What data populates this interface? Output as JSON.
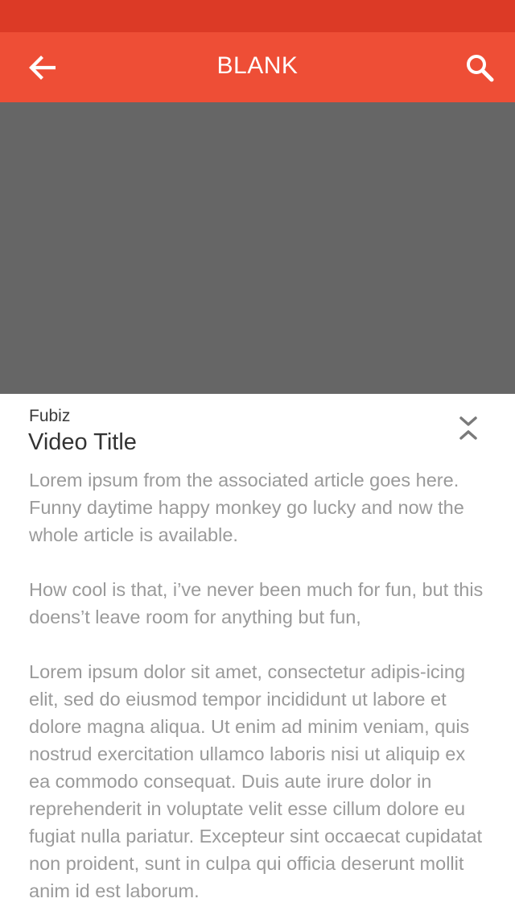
{
  "app_bar": {
    "title": "BLANK",
    "back_icon": "arrow-back-icon",
    "search_icon": "search-icon"
  },
  "colors": {
    "status_bar": "#dc3a26",
    "app_bar": "#ee4e36",
    "video_placeholder": "#666666",
    "body_text": "#9a9a9a"
  },
  "video": {
    "source": "Fubiz",
    "title": "Video Title",
    "toggle_icon": "collapse-expand-chevrons-icon"
  },
  "article": {
    "paragraphs": [
      "Lorem ipsum from the associated article goes here. Funny daytime happy monkey go lucky and now the whole article is available.",
      "How cool is that, i’ve never been much for fun, but this doens’t leave room for anything but fun,",
      "Lorem ipsum dolor sit amet, consectetur adipis-icing elit, sed do eiusmod tempor incididunt ut labore et dolore magna aliqua. Ut enim ad minim veniam, quis nostrud exercitation ullamco laboris nisi ut aliquip ex ea commodo consequat. Duis aute irure dolor in reprehenderit in voluptate velit esse cillum dolore eu fugiat nulla pariatur. Excepteur sint occaecat cupidatat non proident, sunt in culpa qui officia deserunt mollit anim id est laborum."
    ]
  }
}
